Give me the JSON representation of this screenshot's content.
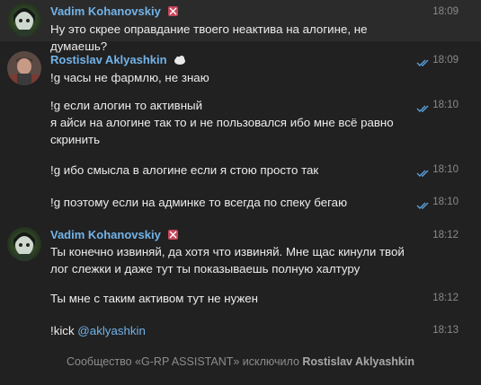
{
  "colors": {
    "background": "#212121",
    "highlight_row": "#2b2b2b",
    "author_name": "#72b3e8",
    "text": "#ececec",
    "time": "#8a8a8a",
    "read_ticks": "#5aa0db"
  },
  "messages": [
    {
      "author": "Vadim Kohanovskiy",
      "author_badge": "flag-icon",
      "time": "18:09",
      "text": "Ну это скрее оправдание твоего неактива на алогине, не думаешь?"
    },
    {
      "author": "Rostislav Aklyashkin",
      "author_badge": "cloud-icon",
      "time": "18:09",
      "read": true,
      "text": "!g часы не фармлю, не знаю"
    },
    {
      "time": "18:10",
      "read": true,
      "text": "!g если алогин то активный\nя айси на алогине так то и не пользовался ибо мне всё равно скринить"
    },
    {
      "time": "18:10",
      "read": true,
      "text": "!g ибо смысла в алогине если я стою просто так"
    },
    {
      "time": "18:10",
      "read": true,
      "text": "!g поэтому если на админке то всегда по спеку бегаю"
    },
    {
      "author": "Vadim Kohanovskiy",
      "author_badge": "flag-icon",
      "time": "18:12",
      "text": "Ты конечно извиняй, да хотя что извиняй. Мне щас кинули твой лог слежки и даже тут ты показываешь полную халтуру"
    },
    {
      "time": "18:12",
      "text": "Ты мне с таким активом тут не нужен"
    },
    {
      "time": "18:13",
      "text_prefix": "!kick ",
      "mention": "@aklyashkin"
    }
  ],
  "service_message": {
    "prefix": "Сообщество «G-RP ASSISTANT» исключило ",
    "user": "Rostislav Aklyashkin"
  }
}
